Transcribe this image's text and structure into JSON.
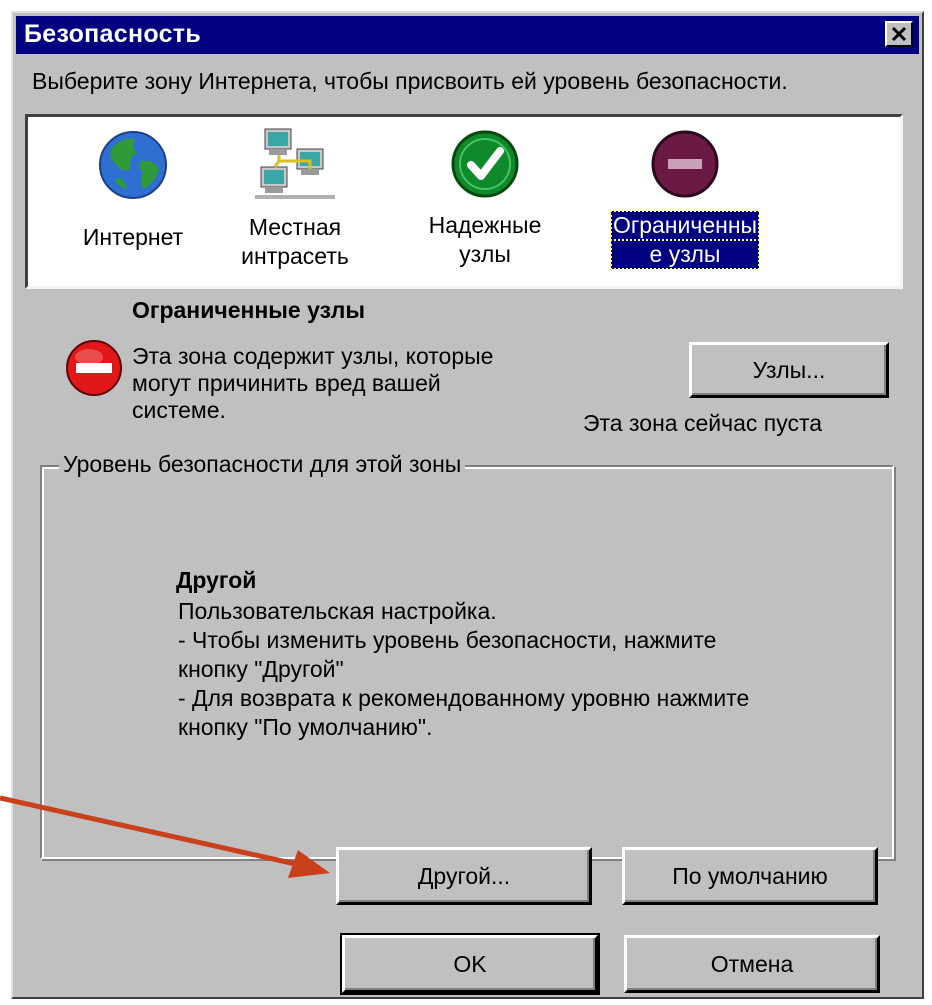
{
  "dialog": {
    "title": "Безопасность",
    "close_glyph": "✕",
    "instruction": "Выберите зону Интернета, чтобы присвоить ей уровень безопасности."
  },
  "zones": [
    {
      "label_line1": "Интернет",
      "label_line2": "",
      "icon": "globe-icon"
    },
    {
      "label_line1": "Местная",
      "label_line2": "интрасеть",
      "icon": "network-computers-icon"
    },
    {
      "label_line1": "Надежные",
      "label_line2": "узлы",
      "icon": "green-checkmark-icon"
    },
    {
      "label_line1": "Ограниченны",
      "label_line2": "е узлы",
      "icon": "restricted-sign-icon",
      "selected": true
    }
  ],
  "zone_info": {
    "title": "Ограниченные узлы",
    "desc_line1": "Эта зона содержит узлы, которые",
    "desc_line2": "могут причинить вред вашей",
    "desc_line3": "системе.",
    "sites_button": "Узлы...",
    "empty_status": "Эта зона сейчас пуста"
  },
  "security_level": {
    "group_label": "Уровень безопасности для этой зоны",
    "level_name": "Другой",
    "line1": "Пользовательская настройка.",
    "line2": "- Чтобы изменить уровень безопасности, нажмите",
    "line3": "кнопку \"Другой\"",
    "line4": "- Для возврата к рекомендованному уровню нажмите",
    "line5": "кнопку \"По умолчанию\".",
    "custom_button": "Другой...",
    "default_button": "По умолчанию"
  },
  "footer": {
    "ok_button": "OK",
    "cancel_button": "Отмена"
  },
  "colors": {
    "titlebar": "#000080",
    "dialog_face": "#c0c0c0",
    "annotation_arrow": "#c8401c"
  }
}
